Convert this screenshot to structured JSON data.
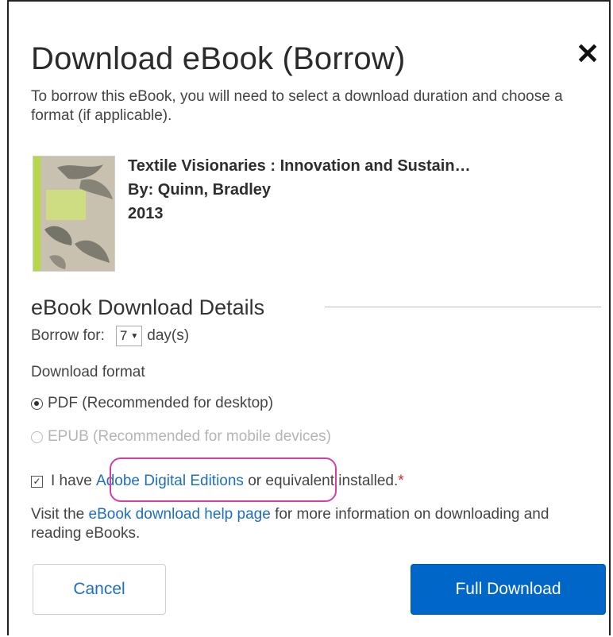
{
  "dialog": {
    "title": "Download eBook (Borrow)",
    "close_glyph": "✕",
    "intro": "To borrow this eBook, you will need to select a download duration and choose a format (if applicable)."
  },
  "book": {
    "title": "Textile Visionaries : Innovation and Sustain…",
    "author": "By: Quinn, Bradley",
    "year": "2013",
    "cover_icon": "book-cover-image"
  },
  "details": {
    "heading": "eBook Download Details",
    "borrow_label": "Borrow for:",
    "borrow_value": "7",
    "borrow_unit": "day(s)",
    "format_label": "Download format",
    "formats": [
      {
        "label": "PDF (Recommended for desktop)",
        "selected": true,
        "enabled": true
      },
      {
        "label": "EPUB (Recommended for mobile devices)",
        "selected": false,
        "enabled": false
      }
    ]
  },
  "agreement": {
    "prefix": "I have",
    "link": "Adobe Digital Editions",
    "suffix": "or equivalent installed.",
    "required_mark": "*",
    "checked": true
  },
  "help": {
    "prefix": "Visit the",
    "link": "eBook download help page",
    "suffix": "for more information on downloading and reading eBooks."
  },
  "buttons": {
    "cancel": "Cancel",
    "download": "Full Download"
  },
  "colors": {
    "link": "#1f6fbf",
    "primary": "#0066c8",
    "highlight": "#d33fa6",
    "required": "#d12b2b"
  }
}
